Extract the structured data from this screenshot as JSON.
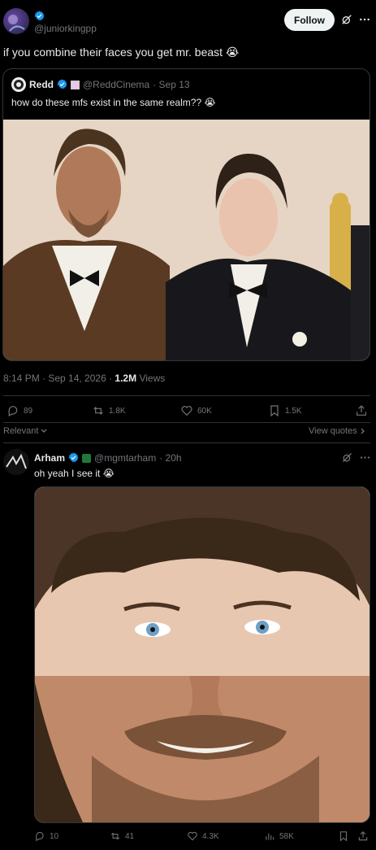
{
  "tweet": {
    "handle": "@juniorkingpp",
    "follow_label": "Follow",
    "text": "if you combine their faces you get mr. beast 😭",
    "timestamp": "8:14 PM · Sep 14, 2026 · ",
    "views_count": "1.2M",
    "views_label": " Views",
    "actions": {
      "replies": "89",
      "reposts": "1.8K",
      "likes": "60K",
      "bookmarks": "1.5K"
    }
  },
  "quote": {
    "name": "Redd",
    "handle": "@ReddCinema",
    "date": "· Sep 13",
    "text": "how do these mfs exist in the same realm?? 😭"
  },
  "sort": {
    "label": "Relevant",
    "view_quotes": "View quotes"
  },
  "reply": {
    "name": "Arham",
    "handle": "@mgmtarham",
    "time": "· 20h",
    "text": "oh yeah I see it 😭",
    "actions": {
      "replies": "10",
      "reposts": "41",
      "likes": "4.3K",
      "views": "58K"
    }
  },
  "colors": {
    "accent": "#1d9bf0",
    "background": "#000000",
    "muted": "#71767b"
  },
  "icons": [
    "verified-badge-icon",
    "grok-icon",
    "more-icon",
    "reply-icon",
    "repost-icon",
    "like-icon",
    "bookmark-icon",
    "share-icon",
    "views-icon",
    "chevron-down-icon",
    "chevron-right-icon"
  ]
}
